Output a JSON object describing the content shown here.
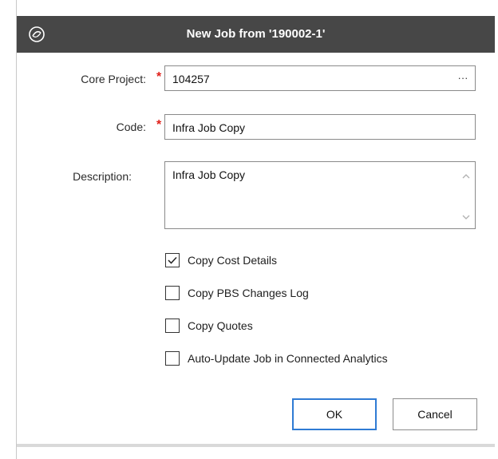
{
  "dialog": {
    "title": "New Job from '190002-1'",
    "logo_icon": "swirl-logo-icon"
  },
  "form": {
    "core_project": {
      "label": "Core Project:",
      "value": "104257",
      "browse_label": "···"
    },
    "code": {
      "label": "Code:",
      "value": "Infra Job Copy"
    },
    "description": {
      "label": "Description:",
      "value": "Infra Job Copy"
    },
    "required_marker": "*"
  },
  "options": [
    {
      "label": "Copy Cost Details",
      "checked": true
    },
    {
      "label": "Copy PBS Changes Log",
      "checked": false
    },
    {
      "label": "Copy Quotes",
      "checked": false
    },
    {
      "label": "Auto-Update Job in Connected Analytics",
      "checked": false
    }
  ],
  "buttons": {
    "ok": "OK",
    "cancel": "Cancel"
  },
  "colors": {
    "titlebar": "#474747",
    "required": "#e0201a",
    "focus": "#2f7bd4"
  }
}
